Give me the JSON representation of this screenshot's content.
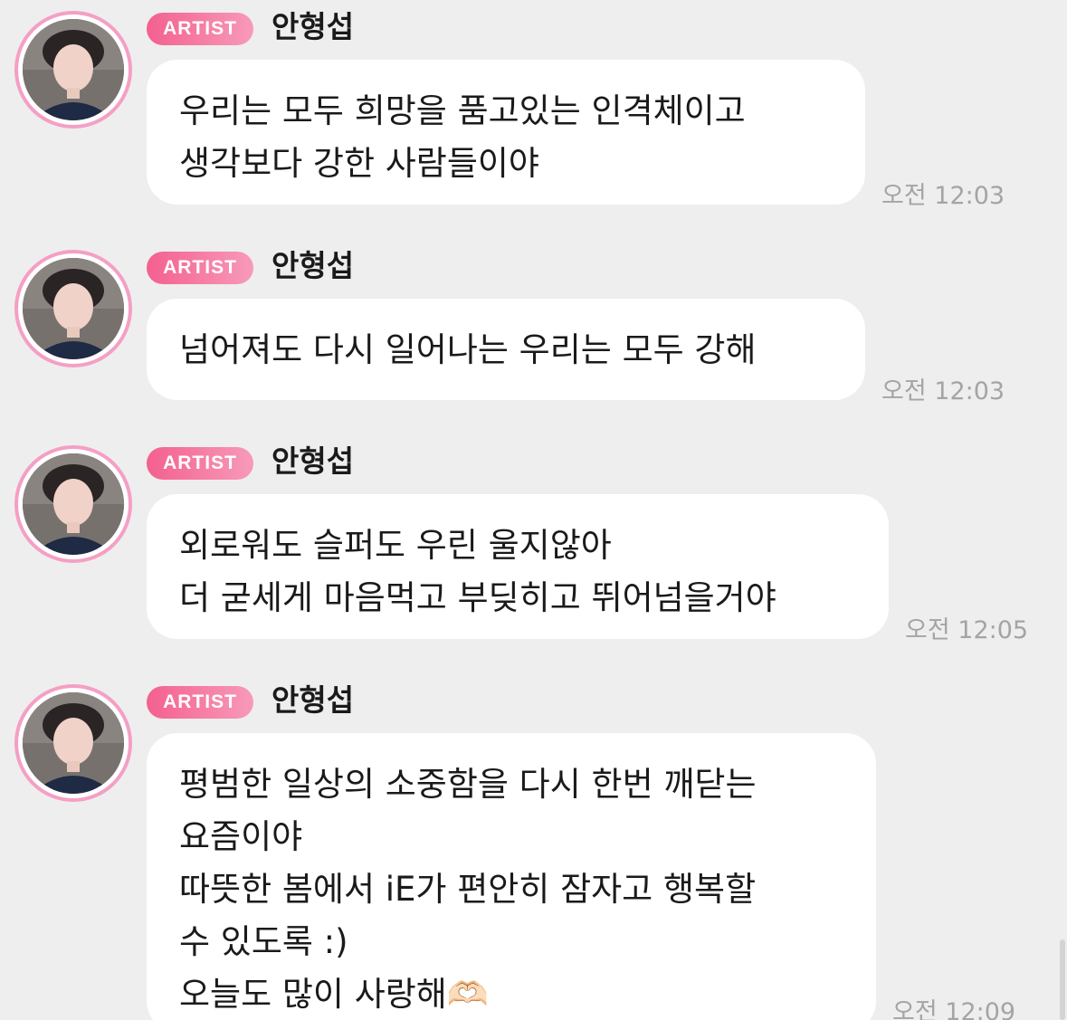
{
  "messages": [
    {
      "badge": "ARTIST",
      "name": "안형섭",
      "lines": [
        "우리는 모두 희망을 품고있는 인격체이고",
        "생각보다 강한 사람들이야"
      ],
      "time": "오전 12:03"
    },
    {
      "badge": "ARTIST",
      "name": "안형섭",
      "lines": [
        "넘어져도 다시 일어나는 우리는 모두 강해"
      ],
      "time": "오전 12:03"
    },
    {
      "badge": "ARTIST",
      "name": "안형섭",
      "lines": [
        "외로워도 슬퍼도 우린 울지않아",
        "더 굳세게 마음먹고 부딪히고 뛰어넘을거야"
      ],
      "time": "오전 12:05"
    },
    {
      "badge": "ARTIST",
      "name": "안형섭",
      "lines": [
        "평범한 일상의 소중함을 다시 한번 깨닫는",
        "요즘이야",
        "따뜻한 봄에서 iE가 편안히 잠자고 행복할",
        "수 있도록 :)",
        "오늘도 많이 사랑해🫶🏻"
      ],
      "time": "오전 12:09"
    }
  ],
  "colors": {
    "background": "#eeeeef",
    "badge_start": "#f4608f",
    "badge_end": "#f79ab9",
    "avatar_ring": "#f59fc4",
    "bubble": "#ffffff",
    "timestamp": "#a4a4a6"
  },
  "icons": {
    "heart_hands": "heart-hands-emoji"
  }
}
